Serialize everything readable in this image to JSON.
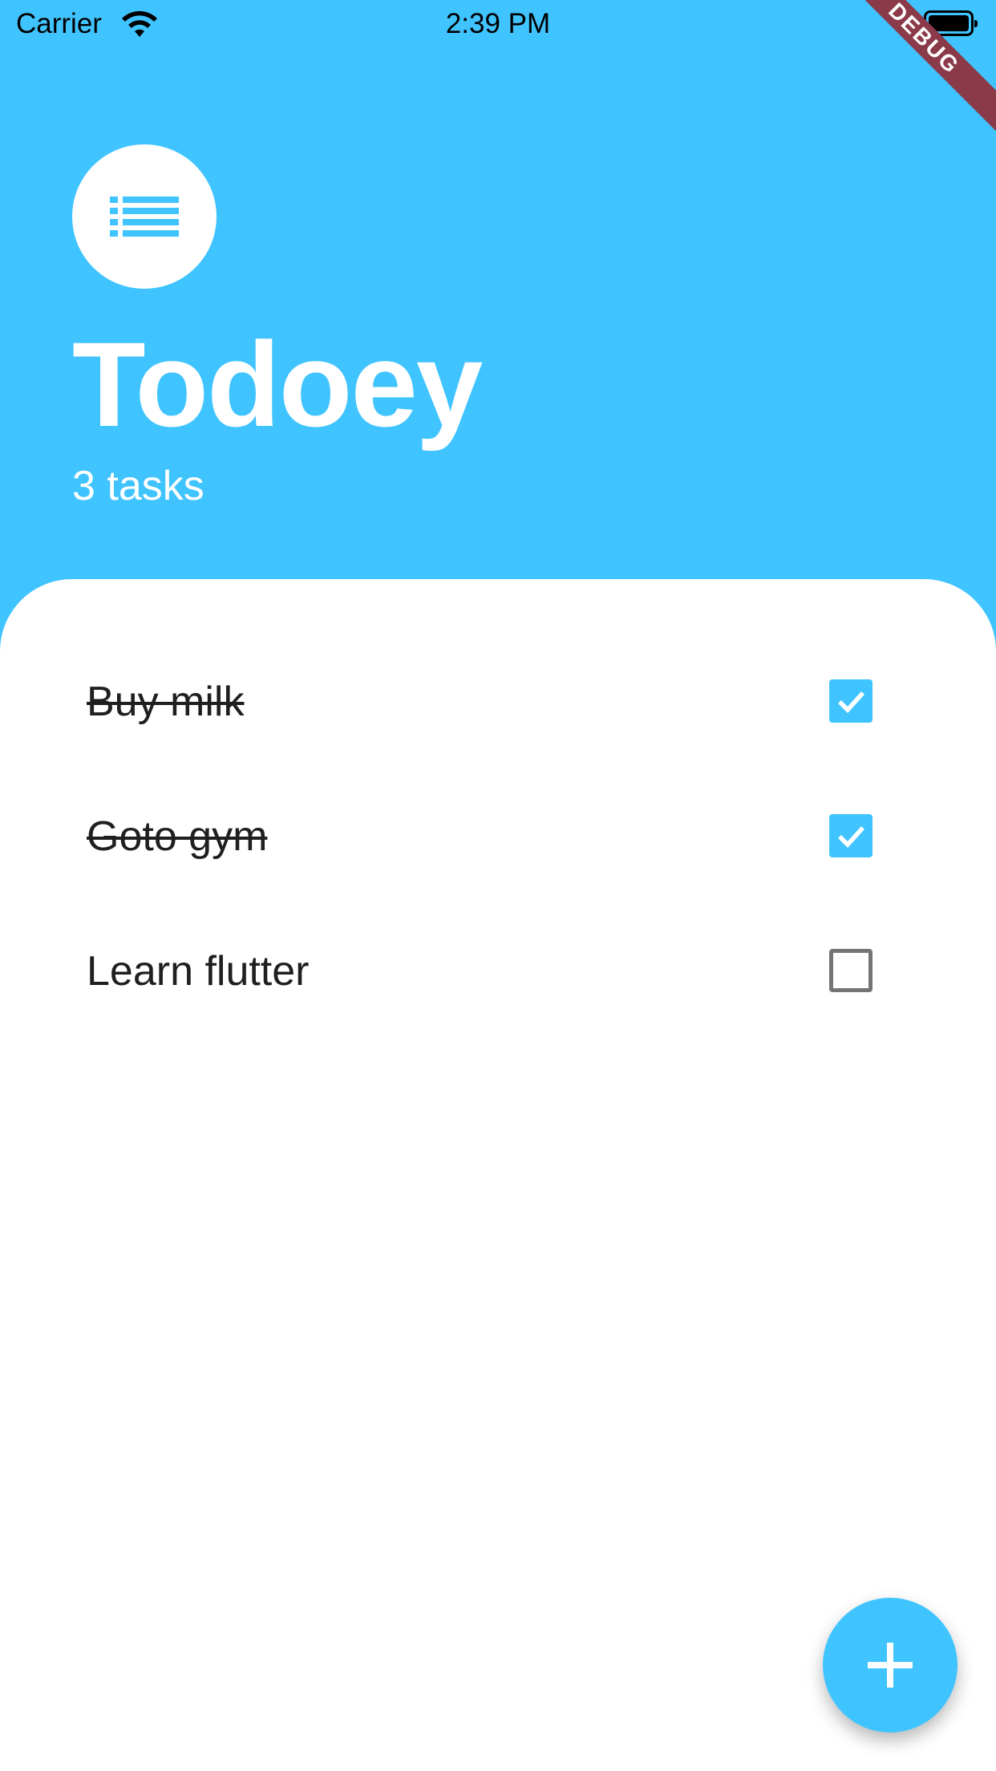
{
  "status_bar": {
    "carrier": "Carrier",
    "time": "2:39 PM"
  },
  "debug_banner": "DEBUG",
  "header": {
    "title": "Todoey",
    "task_count": "3 tasks"
  },
  "tasks": [
    {
      "label": "Buy milk",
      "done": true
    },
    {
      "label": "Goto gym",
      "done": true
    },
    {
      "label": "Learn flutter",
      "done": false
    }
  ],
  "colors": {
    "accent": "#40c4ff",
    "debug": "#8b3a4a"
  },
  "icons": {
    "header": "list-icon",
    "fab": "plus-icon"
  }
}
